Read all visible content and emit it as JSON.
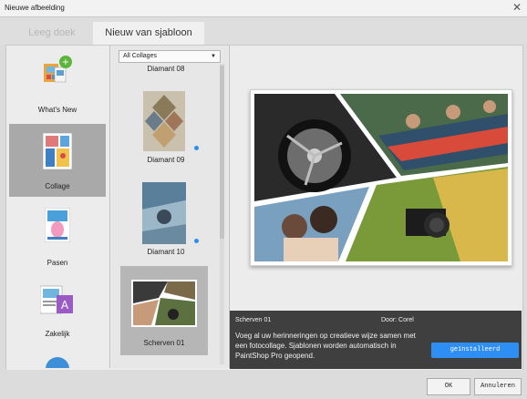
{
  "window": {
    "title": "Nieuwe afbeelding"
  },
  "tabs": [
    {
      "label": "Leeg doek",
      "active": false
    },
    {
      "label": "Nieuw van sjabloon",
      "active": true
    }
  ],
  "categories": [
    {
      "label": "What's New",
      "icon": "whats-new-icon",
      "selected": false
    },
    {
      "label": "Collage",
      "icon": "collage-icon",
      "selected": true
    },
    {
      "label": "Pasen",
      "icon": "easter-icon",
      "selected": false
    },
    {
      "label": "Zakelijk",
      "icon": "business-icon",
      "selected": false
    }
  ],
  "templates": {
    "filter": {
      "value": "All Collages"
    },
    "items": [
      {
        "label": "Diamant 08",
        "badge": false
      },
      {
        "label": "Diamant 09",
        "badge": true
      },
      {
        "label": "Diamant 10",
        "badge": true
      },
      {
        "label": "Scherven 01",
        "selected": true
      }
    ]
  },
  "info": {
    "name": "Scherven 01",
    "author": "Door: Corel",
    "description": "Voeg al uw herinneringen op creatieve wijze samen met een fotocollage. Sjablonen worden automatisch in PaintShop Pro geopend.",
    "install_label": "geïnstalleerd"
  },
  "footer": {
    "ok_label": "OK",
    "cancel_label": "Annuleren"
  },
  "colors": {
    "accent": "#2f8ef4",
    "info_bg": "#3f3f3f",
    "selection": "#a9a9a9"
  }
}
